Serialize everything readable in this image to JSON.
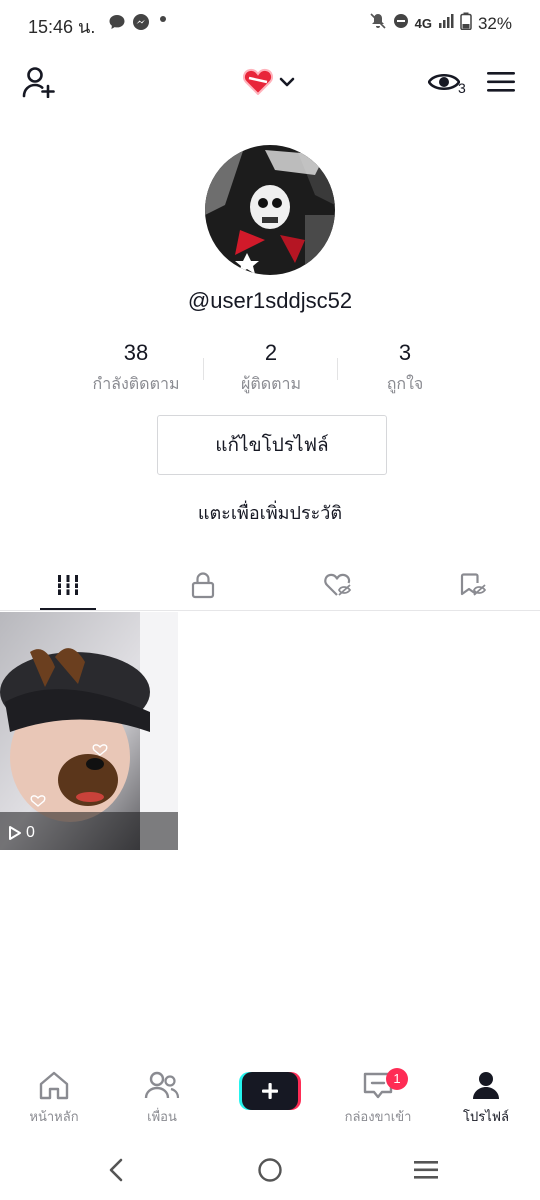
{
  "status_bar": {
    "time": "15:46 น.",
    "network": "4G",
    "battery": "32%"
  },
  "top_bar": {
    "eye_count": "3"
  },
  "profile": {
    "username": "@user1sddjsc52",
    "stats": [
      {
        "value": "38",
        "label": "กำลังติดตาม"
      },
      {
        "value": "2",
        "label": "ผู้ติดตาม"
      },
      {
        "value": "3",
        "label": "ถูกใจ"
      }
    ],
    "edit_button": "แก้ไขโปรไฟล์",
    "bio_prompt": "แตะเพื่อเพิ่มประวัติ"
  },
  "tabs": [
    "videos-grid-icon",
    "lock-icon",
    "liked-hidden-icon",
    "saved-hidden-icon"
  ],
  "videos": [
    {
      "views": "0"
    }
  ],
  "bottom_nav": {
    "items": [
      {
        "label": "หน้าหลัก",
        "icon": "home-icon"
      },
      {
        "label": "เพื่อน",
        "icon": "friends-icon"
      },
      {
        "label": "",
        "icon": "create-plus-icon"
      },
      {
        "label": "กล่องขาเข้า",
        "icon": "inbox-icon",
        "badge": "1"
      },
      {
        "label": "โปรไฟล์",
        "icon": "profile-icon",
        "active": true
      }
    ]
  },
  "colors": {
    "accent": "#fe2c55",
    "text": "#161823",
    "secondary_text": "#8a8b91"
  }
}
